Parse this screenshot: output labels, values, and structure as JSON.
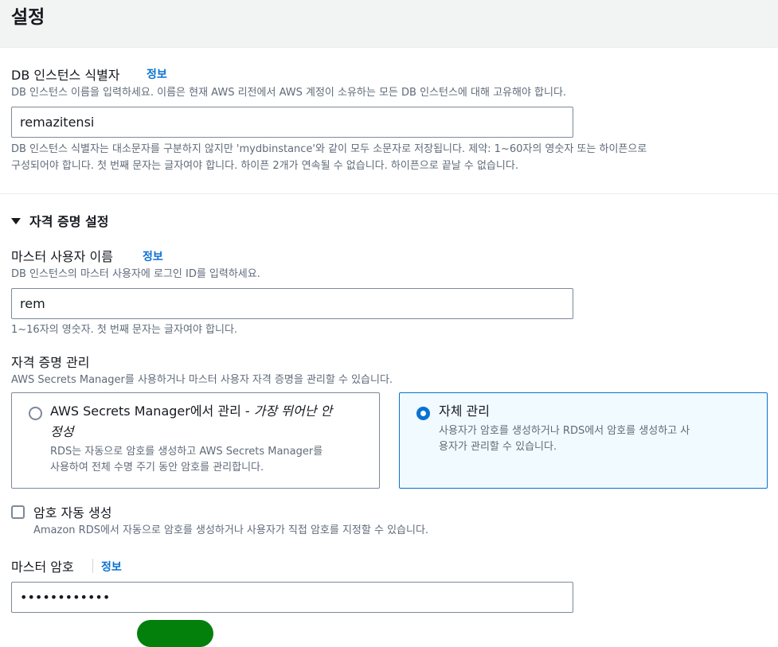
{
  "header": {
    "title": "설정"
  },
  "db_identifier": {
    "label": "DB 인스턴스 식별자",
    "info": "정보",
    "description": "DB 인스턴스 이름을 입력하세요. 이름은 현재 AWS 리전에서 AWS 계정이 소유하는 모든 DB 인스턴스에 대해 고유해야 합니다.",
    "value": "remazitensi",
    "constraint_line1": "DB 인스턴스 식별자는 대소문자를 구분하지 않지만 'mydbinstance'와 같이 모두 소문자로 저장됩니다. 제약: 1~60자의 영숫자 또는 하이픈으로",
    "constraint_line2": "구성되어야 합니다. 첫 번째 문자는 글자여야 합니다. 하이픈 2개가 연속될 수 없습니다. 하이픈으로 끝날 수 없습니다."
  },
  "credentials": {
    "section_title": "자격 증명 설정",
    "master_username": {
      "label": "마스터 사용자 이름",
      "info": "정보",
      "description": "DB 인스턴스의 마스터 사용자에 로그인 ID를 입력하세요.",
      "value": "rem",
      "constraint": "1~16자의 영숫자. 첫 번째 문자는 글자여야 합니다."
    },
    "management": {
      "label": "자격 증명 관리",
      "description": "AWS Secrets Manager를 사용하거나 마스터 사용자 자격 증명을 관리할 수 있습니다.",
      "options": [
        {
          "title": "AWS Secrets Manager에서 관리 - ",
          "title_emphasis_line1": "가장 뛰어난 안",
          "title_emphasis_line2": "정성",
          "desc_line1": "RDS는 자동으로 암호를 생성하고 AWS Secrets Manager를",
          "desc_line2": "사용하여 전체 수명 주기 동안 암호를 관리합니다.",
          "selected": false
        },
        {
          "title": "자체 관리",
          "desc_line1": "사용자가 암호를 생성하거나 RDS에서 암호를 생성하고 사",
          "desc_line2": "용자가 관리할 수 있습니다.",
          "selected": true
        }
      ]
    },
    "auto_generate": {
      "label": "암호 자동 생성",
      "description": "Amazon RDS에서 자동으로 암호를 생성하거나 사용자가 직접 암호를 지정할 수 있습니다.",
      "checked": false
    },
    "master_password": {
      "label": "마스터 암호",
      "info": "정보",
      "value": "••••••••••••"
    }
  },
  "colors": {
    "link": "#0972d3",
    "selected_card_bg": "#f1faff",
    "accent_green": "#037f0c"
  }
}
